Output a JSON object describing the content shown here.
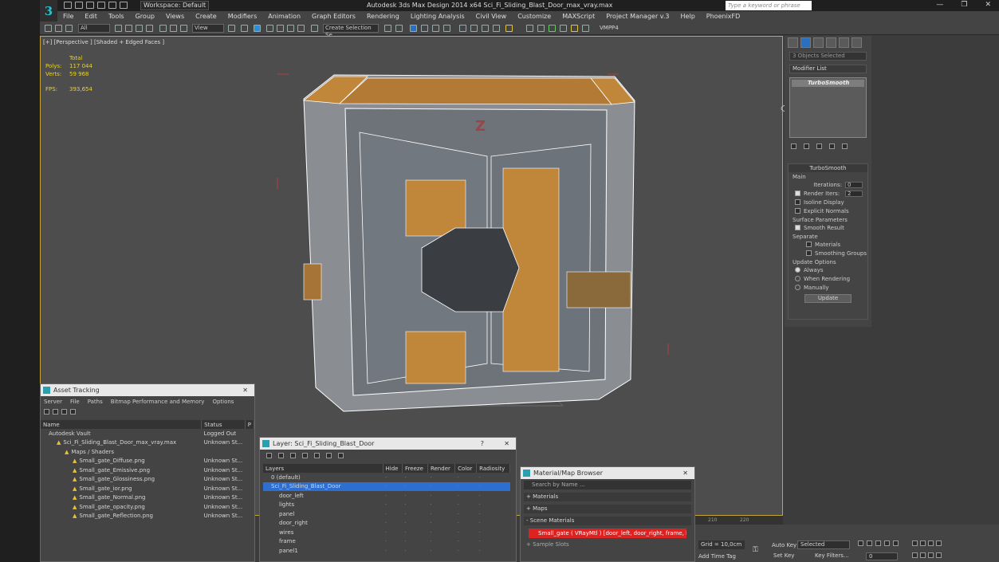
{
  "app": {
    "logo": "3",
    "workspace": "Workspace: Default",
    "title": "Autodesk 3ds Max Design 2014 x64     Sci_Fi_Sliding_Blast_Door_max_vray.max",
    "search_placeholder": "Type a keyword or phrase",
    "win_controls": [
      "—",
      "❐",
      "✕"
    ]
  },
  "menu": [
    "File",
    "Edit",
    "Tools",
    "Group",
    "Views",
    "Create",
    "Modifiers",
    "Animation",
    "Graph Editors",
    "Rendering",
    "Lighting Analysis",
    "Civil View",
    "Customize",
    "MAXScript",
    "Project Manager v.3",
    "Help",
    "PhoenixFD"
  ],
  "toolbar": {
    "filter": "All",
    "refcoord": "View",
    "selset": "Create Selection Se",
    "vmpp": "VMPP4"
  },
  "viewport": {
    "label": "[+] [Perspective ] [Shaded + Edged Faces ]",
    "stats_header": "Total",
    "polys_label": "Polys:",
    "polys": "117 044",
    "verts_label": "Verts:",
    "verts": "59 968",
    "fps_label": "FPS:",
    "fps": "393,654"
  },
  "command_panel": {
    "selection": "3 Objects Selected",
    "modifier_list": "Modifier List",
    "stack_item": "TurboSmooth",
    "rollout": "TurboSmooth",
    "main": "Main",
    "iterations_label": "Iterations:",
    "iterations": "0",
    "render_iters_label": "Render Iters:",
    "render_iters": "2",
    "isoline": "Isoline Display",
    "explicit": "Explicit Normals",
    "surface": "Surface Parameters",
    "smooth": "Smooth Result",
    "separate": "Separate",
    "materials": "Materials",
    "smoothing": "Smoothing Groups",
    "update_options": "Update Options",
    "always": "Always",
    "when_render": "When Rendering",
    "manually": "Manually",
    "update": "Update"
  },
  "asset": {
    "title": "Asset Tracking",
    "menu": [
      "Server",
      "File",
      "Paths",
      "Bitmap Performance and Memory",
      "Options"
    ],
    "cols": [
      "Name",
      "Status",
      "P"
    ],
    "rows": [
      {
        "name": "Autodesk Vault",
        "status": "Logged Out",
        "indent": 1
      },
      {
        "name": "Sci_Fi_Sliding_Blast_Door_max_vray.max",
        "status": "Unknown St...",
        "indent": 2
      },
      {
        "name": "Maps / Shaders",
        "status": "",
        "indent": 3
      },
      {
        "name": "Small_gate_Diffuse.png",
        "status": "Unknown St...",
        "indent": 4
      },
      {
        "name": "Small_gate_Emissive.png",
        "status": "Unknown St...",
        "indent": 4
      },
      {
        "name": "Small_gate_Glossiness.png",
        "status": "Unknown St...",
        "indent": 4
      },
      {
        "name": "Small_gate_ior.png",
        "status": "Unknown St...",
        "indent": 4
      },
      {
        "name": "Small_gate_Normal.png",
        "status": "Unknown St...",
        "indent": 4
      },
      {
        "name": "Small_gate_opacity.png",
        "status": "Unknown St...",
        "indent": 4
      },
      {
        "name": "Small_gate_Reflection.png",
        "status": "Unknown St...",
        "indent": 4
      }
    ]
  },
  "layer": {
    "title": "Layer: Sci_Fi_Sliding_Blast_Door",
    "help": "?",
    "cols": [
      "Layers",
      "Hide",
      "Freeze",
      "Render",
      "Color",
      "Radiosity"
    ],
    "rows": [
      {
        "name": "0 (default)",
        "sel": false,
        "indent": 1
      },
      {
        "name": "Sci_Fi_Sliding_Blast_Door",
        "sel": true,
        "indent": 1
      },
      {
        "name": "door_left",
        "sel": false,
        "indent": 2
      },
      {
        "name": "lights",
        "sel": false,
        "indent": 2
      },
      {
        "name": "panel",
        "sel": false,
        "indent": 2
      },
      {
        "name": "door_right",
        "sel": false,
        "indent": 2
      },
      {
        "name": "wires",
        "sel": false,
        "indent": 2
      },
      {
        "name": "frame",
        "sel": false,
        "indent": 2
      },
      {
        "name": "panel1",
        "sel": false,
        "indent": 2
      }
    ]
  },
  "material": {
    "title": "Material/Map Browser",
    "search": "Search by Name ...",
    "materials": "+ Materials",
    "maps": "+ Maps",
    "scene": "- Scene Materials",
    "item": "Small_gate ( VRayMtl ) [door_left, door_right, frame, ligh...",
    "sample": "+ Sample Slots"
  },
  "status": {
    "grid": "Grid = 10,0cm",
    "add_time_tag": "Add Time Tag",
    "auto_key": "Auto Key",
    "selected": "Selected",
    "set_key": "Set Key",
    "key_filters": "Key Filters...",
    "frame": "0",
    "t1": "210",
    "t2": "220"
  }
}
